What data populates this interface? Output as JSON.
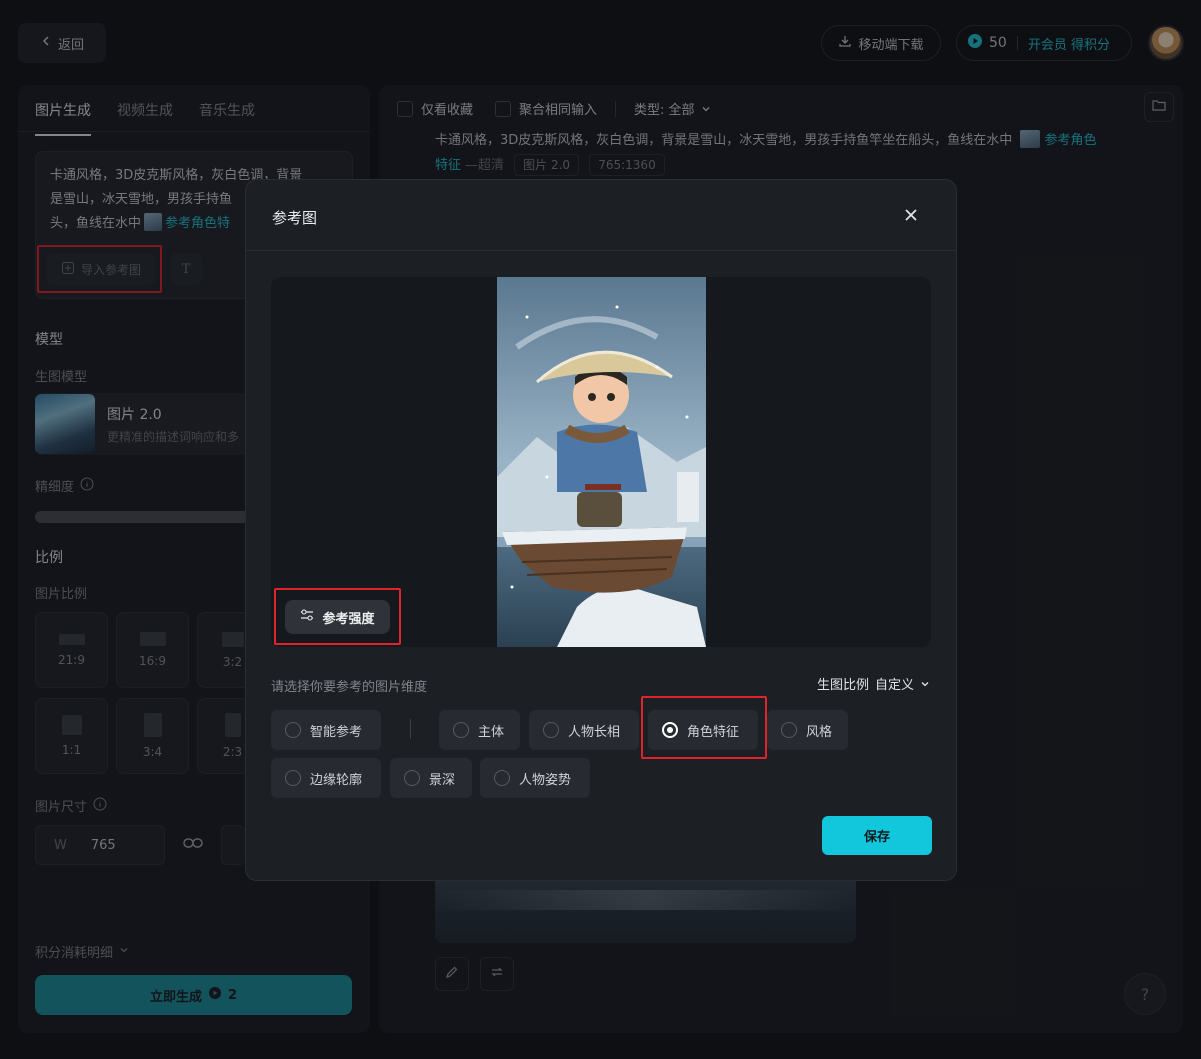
{
  "header": {
    "back_label": "返回",
    "download_label": "移动端下载",
    "points": "50",
    "vip_label": "开会员 得积分"
  },
  "left": {
    "tabs": [
      {
        "label": "图片生成",
        "active": true
      },
      {
        "label": "视频生成",
        "active": false
      },
      {
        "label": "音乐生成",
        "active": false
      }
    ],
    "prompt_text": "卡通风格，3D皮克斯风格，灰白色调，背景是雪山，冰天雪地，男孩手持鱼竿坐在船头，鱼线在水中",
    "prompt_ref_chip": "参考角色特征",
    "prompt_visible_line1": "卡通风格，3D皮克斯风格，灰白色调，背景",
    "prompt_visible_line2": "是雪山，冰天雪地，男孩手持鱼",
    "prompt_visible_line3": "头，鱼线在水中",
    "prompt_visible_chip": "参考角色特",
    "import_ref_label": "导入参考图",
    "model_section": "模型",
    "model_sublabel": "生图模型",
    "model_name": "图片 2.0",
    "model_desc": "更精准的描述词响应和多",
    "precision_label": "精细度",
    "ratio_section": "比例",
    "ratio_sublabel": "图片比例",
    "ratios": [
      "21:9",
      "16:9",
      "3:2",
      "1:1",
      "3:4",
      "2:3"
    ],
    "size_label": "图片尺寸",
    "width_prefix": "W",
    "width_value": "765",
    "cost_detail": "积分消耗明细",
    "generate_label": "立即生成",
    "generate_cost": "2"
  },
  "right": {
    "filter_fav": "仅看收藏",
    "filter_merge": "聚合相同输入",
    "filter_type": "类型: 全部",
    "prompt_text": "卡通风格，3D皮克斯风格，灰白色调，背景是雪山，冰天雪地，男孩手持鱼竿坐在船头，鱼线在水中",
    "prompt_ref": "参考角色",
    "prompt_ref_line2": "特征",
    "quality": "超清",
    "model_tag": "图片 2.0",
    "size_tag": "765:1360"
  },
  "modal": {
    "title": "参考图",
    "strength_label": "参考强度",
    "dimension_prompt": "请选择你要参考的图片维度",
    "ratio_select_label": "生图比例",
    "ratio_select_value": "自定义",
    "options": [
      {
        "label": "智能参考",
        "selected": false
      },
      {
        "label": "主体",
        "selected": false
      },
      {
        "label": "人物长相",
        "selected": false
      },
      {
        "label": "角色特征",
        "selected": true
      },
      {
        "label": "风格",
        "selected": false
      },
      {
        "label": "边缘轮廓",
        "selected": false
      },
      {
        "label": "景深",
        "selected": false
      },
      {
        "label": "人物姿势",
        "selected": false
      }
    ],
    "save_label": "保存"
  }
}
